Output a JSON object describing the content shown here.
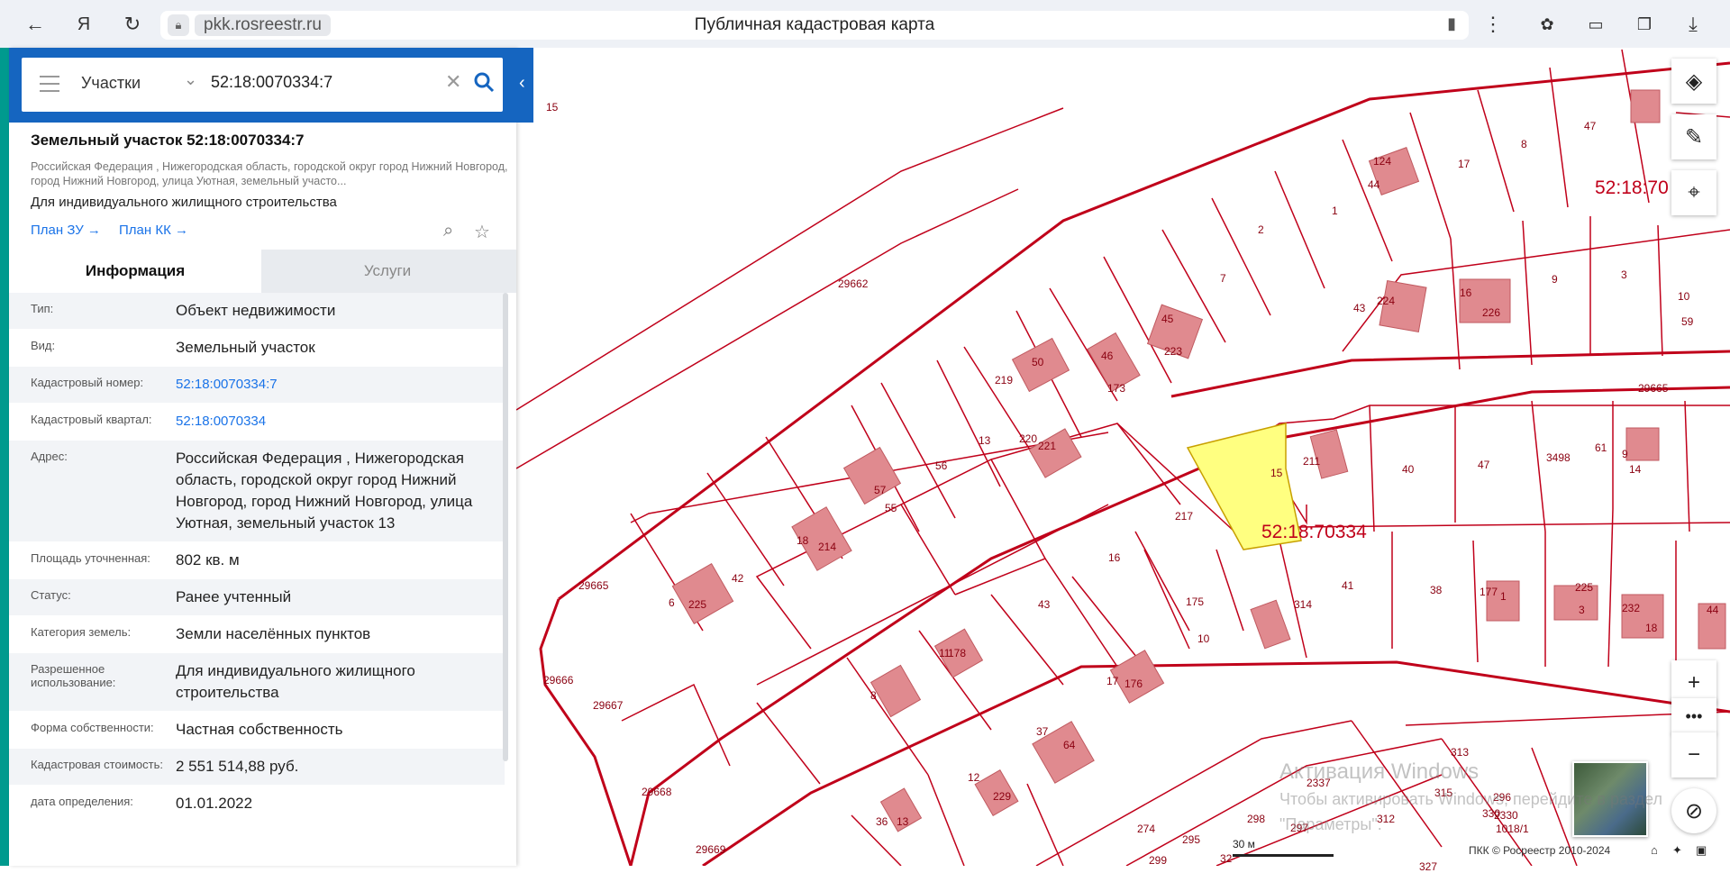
{
  "browser": {
    "domain": "pkk.rosreestr.ru",
    "page_title": "Публичная кадастровая карта"
  },
  "search": {
    "type": "Участки",
    "value": "52:18:0070334:7"
  },
  "object": {
    "title": "Земельный участок 52:18:0070334:7",
    "address_short": "Российская Федерация , Нижегородская область, городской округ город Нижний Новгород, город Нижний Новгород, улица Уютная, земельный участо...",
    "purpose": "Для индивидуального жилищного строительства",
    "links": [
      "План ЗУ →",
      "План КК →"
    ]
  },
  "tabs": [
    "Информация",
    "Услуги"
  ],
  "rows": [
    {
      "label": "Тип:",
      "value": "Объект недвижимости",
      "blue": false
    },
    {
      "label": "Вид:",
      "value": "Земельный участок",
      "blue": false
    },
    {
      "label": "Кадастровый номер:",
      "value": "52:18:0070334:7",
      "blue": true
    },
    {
      "label": "Кадастровый квартал:",
      "value": "52:18:0070334",
      "blue": true
    },
    {
      "label": "Адрес:",
      "value": "Российская Федерация , Нижегородская область, городской округ город Нижний Новгород, город Нижний Новгород, улица Уютная, земельный участок 13",
      "blue": false
    },
    {
      "label": "Площадь уточненная:",
      "value": "802 кв. м",
      "blue": false
    },
    {
      "label": "Статус:",
      "value": "Ранее учтенный",
      "blue": false
    },
    {
      "label": "Категория земель:",
      "value": "Земли населённых пунктов",
      "blue": false
    },
    {
      "label": "Разрешенное использование:",
      "value": "Для индивидуального жилищного строительства",
      "blue": false
    },
    {
      "label": "Форма собственности:",
      "value": "Частная собственность",
      "blue": false
    },
    {
      "label": "Кадастровая стоимость:",
      "value": "2 551 514,88 руб.",
      "blue": false
    },
    {
      "label": "дата определения:",
      "value": "01.01.2022",
      "blue": false
    }
  ],
  "map": {
    "quarter_label_main": "52:18:70334",
    "quarter_label_top": "52:18:70",
    "labels": [
      "15",
      "29662",
      "29665",
      "29666",
      "29667",
      "29668",
      "29669",
      "47",
      "8",
      "17",
      "44",
      "124",
      "1",
      "2",
      "7",
      "45",
      "223",
      "46",
      "173",
      "219",
      "50",
      "220",
      "221",
      "13",
      "56",
      "57",
      "55",
      "18",
      "214",
      "42",
      "6",
      "225",
      "16",
      "43",
      "11",
      "178",
      "10",
      "17",
      "176",
      "37",
      "64",
      "12",
      "229",
      "36",
      "13",
      "8",
      "217",
      "43",
      "224",
      "16",
      "226",
      "9",
      "3",
      "10",
      "59",
      "29665",
      "15",
      "211",
      "40",
      "47",
      "3498",
      "61",
      "9",
      "14",
      "41",
      "38",
      "177",
      "1",
      "225",
      "3",
      "232",
      "18",
      "44",
      "175",
      "314",
      "313",
      "315",
      "296",
      "298",
      "297",
      "312",
      "2337",
      "330",
      "1018/1",
      "2330",
      "274",
      "295",
      "299",
      "32",
      "327"
    ],
    "scale_label": "30 м",
    "copyright": "ПКК © Росреестр 2010-2024",
    "watermark_line1": "Активация Windows",
    "watermark_line2": "Чтобы активировать Windows, перейдите в раздел",
    "watermark_line3": "\"Параметры\"."
  },
  "colors": {
    "accent": "#1565c0",
    "parcel_line": "#c0001a",
    "selected_fill": "#ffff80",
    "building": "#e08a8f"
  }
}
